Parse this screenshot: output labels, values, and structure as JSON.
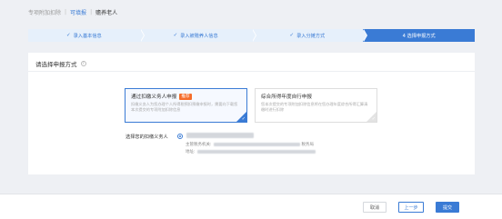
{
  "breadcrumb": {
    "item1": "专项附加扣除",
    "item2": "可填报",
    "item3": "赡养老人",
    "separator": "|"
  },
  "steps": [
    {
      "label": "录入基本信息",
      "done": true
    },
    {
      "label": "录入被赡养人信息",
      "done": true
    },
    {
      "label": "录入分摊方式",
      "done": true
    },
    {
      "label": "4 选择申报方式",
      "done": false
    }
  ],
  "card": {
    "title": "请选择申报方式",
    "help_icon": "?"
  },
  "options": [
    {
      "title": "通过扣缴义务人申报",
      "badge": "推荐",
      "desc": "扣缴义务人为您办理个人所得税预扣预缴申报时，需要向下载您本次提交的专项附加扣除信息",
      "selected": true
    },
    {
      "title": "综合所得年度自行申报",
      "desc": "您本次提交的专项附加扣除信息将在您办理年度综合所得汇算清缴时进行扣除",
      "selected": false
    }
  ],
  "agent": {
    "label": "选择您的扣缴义务人",
    "tax_authority_label": "主管税务机关:",
    "tax_authority_tail": "税务局",
    "address_label": "地址:"
  },
  "footer": {
    "cancel": "取消",
    "prev": "上一步",
    "submit": "提交"
  },
  "colors": {
    "primary": "#3a7bd5",
    "badge": "#f56c2a",
    "step_done_bg": "#e6f0fb"
  }
}
